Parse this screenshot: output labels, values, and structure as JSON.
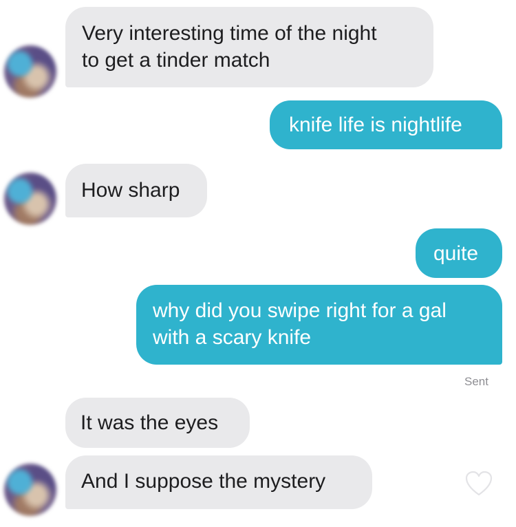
{
  "conversation": {
    "messages": [
      {
        "sender": "them",
        "text": "Very interesting time of the night\nto get a tinder match"
      },
      {
        "sender": "me",
        "text": "knife life is nightlife"
      },
      {
        "sender": "them",
        "text": "How sharp"
      },
      {
        "sender": "me",
        "text": "quite"
      },
      {
        "sender": "me",
        "text": "why did you swipe right for a gal\nwith a scary knife"
      },
      {
        "sender": "them",
        "text": "It was the eyes"
      },
      {
        "sender": "them",
        "text": "And I suppose the mystery"
      }
    ],
    "status_label": "Sent"
  },
  "icons": {
    "avatar": "blurred-profile-photo",
    "like": "heart-outline-icon"
  },
  "colors": {
    "incoming_bubble": "#e9e9eb",
    "outgoing_bubble": "#2fb3cd",
    "incoming_text": "#1d1d1f",
    "outgoing_text": "#ffffff",
    "status_text": "#8e8e93"
  }
}
